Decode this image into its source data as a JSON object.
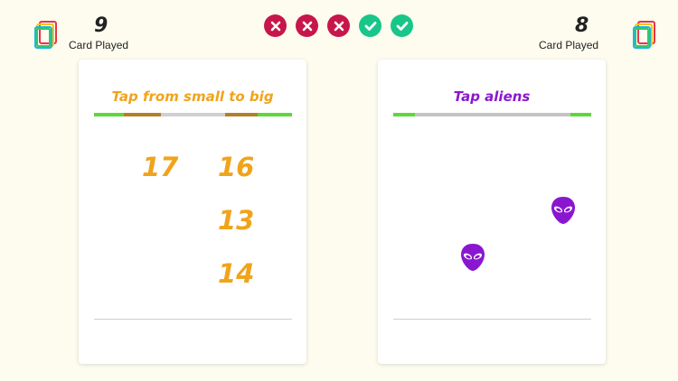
{
  "colors": {
    "background": "#fdfcef",
    "wrong": "#c7164b",
    "correct": "#18c689",
    "number_color": "#f0a41b",
    "alien_color": "#8a17cf",
    "title_left_color": "#f0a41b",
    "title_right_color": "#8a17cf"
  },
  "player_left": {
    "cards_played": "9",
    "label": "Card Played"
  },
  "player_right": {
    "cards_played": "8",
    "label": "Card Played"
  },
  "results": [
    "wrong",
    "wrong",
    "wrong",
    "correct",
    "correct"
  ],
  "card_left": {
    "title": "Tap from small to big",
    "numbers": [
      "17",
      "16",
      "13",
      "14"
    ]
  },
  "card_right": {
    "title": "Tap aliens",
    "alien_icon": "alien-icon",
    "alien_count": 2
  }
}
